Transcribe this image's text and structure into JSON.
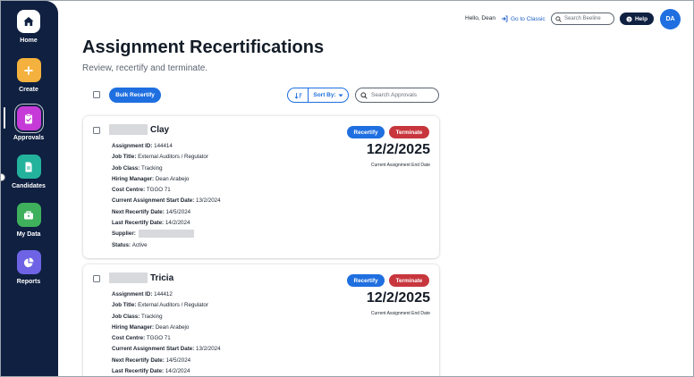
{
  "user": {
    "greeting": "Hello, Dean",
    "initials": "DA"
  },
  "header": {
    "go_to_classic": "Go to Classic",
    "search_placeholder": "Search Beeline",
    "help_label": "Help"
  },
  "sidebar": {
    "items": [
      {
        "label": "Home",
        "icon": "home-icon"
      },
      {
        "label": "Create",
        "icon": "plus-icon"
      },
      {
        "label": "Approvals",
        "icon": "clipboard-check-icon",
        "active": true
      },
      {
        "label": "Candidates",
        "icon": "document-icon"
      },
      {
        "label": "My Data",
        "icon": "briefcase-icon"
      },
      {
        "label": "Reports",
        "icon": "pie-chart-icon"
      }
    ]
  },
  "page": {
    "title": "Assignment Recertifications",
    "subtitle": "Review, recertify and terminate."
  },
  "toolbar": {
    "bulk_label": "Bulk Recertify",
    "sort_label": "Sort By:",
    "search_placeholder": "Search Approvals"
  },
  "card_actions": {
    "recertify": "Recertify",
    "terminate": "Terminate"
  },
  "end_date_label": "Current Assignment End Date",
  "field_labels": {
    "assignment_id": "Assignment ID:",
    "job_title": "Job Title:",
    "job_class": "Job Class:",
    "hiring_manager": "Hiring Manager:",
    "cost_centre": "Cost Centre:",
    "start_date": "Current Assignment Start Date:",
    "next_recertify": "Next Recertify Date:",
    "last_recertify": "Last Recertify Date:",
    "supplier": "Supplier:",
    "status": "Status:"
  },
  "cards": [
    {
      "name": "Clay",
      "end_date": "12/2/2025",
      "assignment_id": "144414",
      "job_title": "External Auditors / Regulator",
      "job_class": "Tracking",
      "hiring_manager": "Dean Arabejo",
      "cost_centre": "TGGO 71",
      "start_date": "13/2/2024",
      "next_recertify": "14/5/2024",
      "last_recertify": "14/2/2024",
      "status": "Active"
    },
    {
      "name": "Tricia",
      "end_date": "12/2/2025",
      "assignment_id": "144412",
      "job_title": "External Auditors / Regulator",
      "job_class": "Tracking",
      "hiring_manager": "Dean Arabejo",
      "cost_centre": "TGGO 71",
      "start_date": "13/2/2024",
      "next_recertify": "14/5/2024",
      "last_recertify": "14/2/2024"
    }
  ]
}
